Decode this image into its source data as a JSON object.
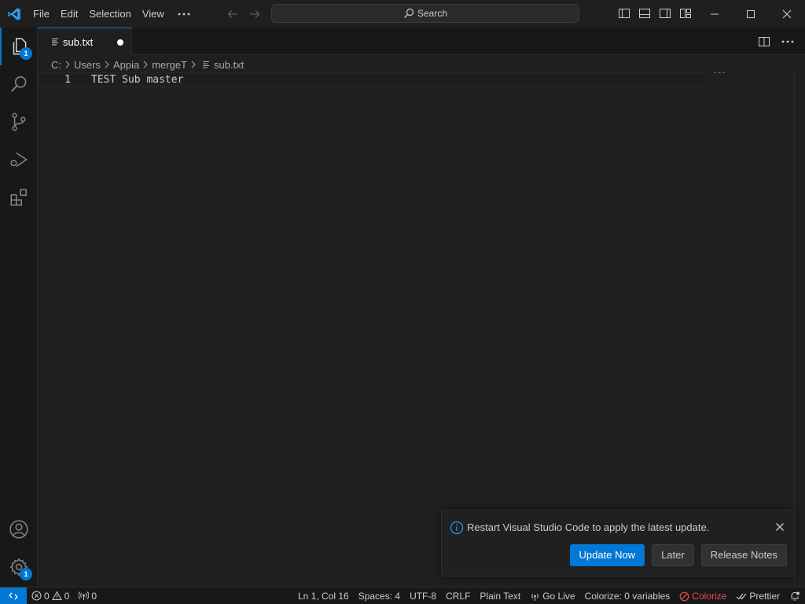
{
  "titlebar": {
    "menu": [
      "File",
      "Edit",
      "Selection",
      "View"
    ],
    "more_icon": "ellipsis-icon",
    "search_label": "Search"
  },
  "activity_bar": {
    "items": [
      {
        "name": "explorer",
        "icon": "files-icon",
        "badge": "1"
      },
      {
        "name": "search",
        "icon": "search-icon"
      },
      {
        "name": "source-control",
        "icon": "source-control-icon"
      },
      {
        "name": "run-debug",
        "icon": "debug-icon"
      },
      {
        "name": "extensions",
        "icon": "extensions-icon"
      }
    ],
    "accounts_icon": "account-icon",
    "settings_icon": "gear-icon",
    "settings_badge": "1"
  },
  "tabs": [
    {
      "label": "sub.txt",
      "dirty": true,
      "active": true
    }
  ],
  "breadcrumb": [
    "C:",
    "Users",
    "Appia",
    "mergeT",
    "sub.txt"
  ],
  "editor": {
    "lines": [
      {
        "number": "1",
        "text": "TEST Sub master"
      }
    ]
  },
  "notification": {
    "message": "Restart Visual Studio Code to apply the latest update.",
    "buttons": {
      "update": "Update Now",
      "later": "Later",
      "release_notes": "Release Notes"
    }
  },
  "statusbar": {
    "errors": "0",
    "warnings": "0",
    "ports": "0",
    "position": "Ln 1, Col 16",
    "spaces": "Spaces: 4",
    "encoding": "UTF-8",
    "eol": "CRLF",
    "language": "Plain Text",
    "go_live": "Go Live",
    "colorize_vars": "Colorize: 0 variables",
    "colorize": "Colorize",
    "prettier": "Prettier"
  },
  "colors": {
    "accent": "#0078d4",
    "background": "#1f1f1f",
    "sidebar": "#181818",
    "error": "#f14c4c"
  }
}
